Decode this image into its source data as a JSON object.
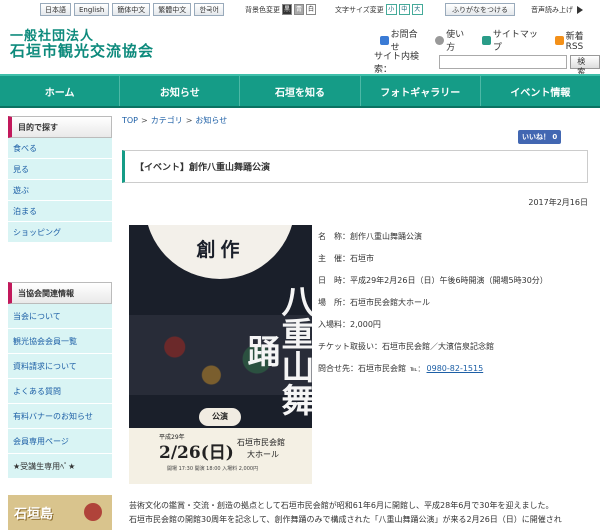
{
  "topbar": {
    "languages": [
      "日本語",
      "English",
      "簡体中文",
      "繁體中文",
      "한국어"
    ],
    "bg_label": "背景色変更",
    "bg_swatches": [
      "黒",
      "青",
      "白"
    ],
    "font_label": "文字サイズ変更",
    "font_sizes": [
      "小",
      "中",
      "大"
    ],
    "furigana": "ふりがなをつける",
    "voice": "音声読み上げ"
  },
  "header": {
    "logo_line1": "一般社団法人",
    "logo_line2": "石垣市観光交流協会",
    "links": [
      "お問合せ",
      "使い方",
      "サイトマップ",
      "新着RSS"
    ],
    "search_label": "サイト内検索：",
    "search_button": "検索"
  },
  "nav": [
    "ホーム",
    "お知らせ",
    "石垣を知る",
    "フォトギャラリー",
    "イベント情報"
  ],
  "sidebar": {
    "section1_title": "目的で探す",
    "section1_items": [
      "食べる",
      "見る",
      "遊ぶ",
      "泊まる",
      "ショッピング"
    ],
    "section2_title": "当協会関連情報",
    "section2_items": [
      "当会について",
      "観光協会会員一覧",
      "資料請求について",
      "よくある質問",
      "有料バナーのお知らせ",
      "会員専用ページ",
      "★受講生専用ﾍﾟ★"
    ],
    "banner_text": "石垣島"
  },
  "main": {
    "breadcrumb": [
      "TOP",
      "カテゴリ",
      "お知らせ"
    ],
    "fb_like": "いいね！ 0",
    "title": "【イベント】創作八重山舞踊公演",
    "date": "2017年2月16日",
    "poster": {
      "top": "創作",
      "main": "八重山舞踊",
      "badge": "公演",
      "year": "平成29年",
      "date": "2/26(日)",
      "venue1": "石垣市民会館",
      "venue2": "大ホール",
      "small": "開場 17:30 開演 18:00 入場料 2,000円"
    },
    "info": [
      {
        "label": "名　称：",
        "value": "創作八重山舞踊公演"
      },
      {
        "label": "主　催：",
        "value": "石垣市"
      },
      {
        "label": "日　時：",
        "value": "平成29年2月26日（日）午後6時開演（開場5時30分）"
      },
      {
        "label": "場　所：",
        "value": "石垣市民会館大ホール"
      },
      {
        "label": "入場料：",
        "value": "2,000円"
      },
      {
        "label": "チケット取扱い：",
        "value": "石垣市民会館／大濱信泉記念館"
      },
      {
        "label": "問合せ先：",
        "value": "石垣市民会館"
      }
    ],
    "tel_label": "℡：",
    "tel": "0980-82-1515",
    "body1": "芸術文化の鑑賞・交流・創造の拠点として石垣市民会館が昭和61年6月に開館し、平成28年6月で30年を迎えました。",
    "body2": "石垣市民会館の開館30周年を記念して、創作舞踊のみで構成された「八重山舞踊公演」が来る2月26日（日）に開催され"
  }
}
